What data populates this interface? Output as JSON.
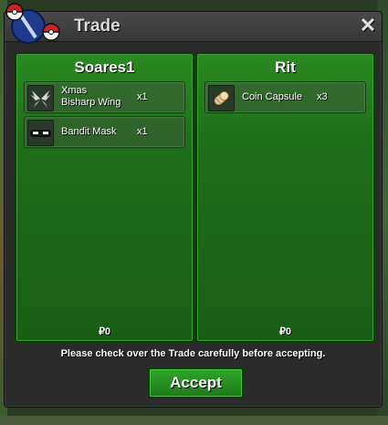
{
  "window": {
    "title": "Trade",
    "close_glyph": "✕"
  },
  "left_panel": {
    "player": "Soares1",
    "items": [
      {
        "name_line1": "Xmas",
        "name_line2": "Bisharp Wing",
        "qty": "x1",
        "icon": "bisharp-wing-icon"
      },
      {
        "name_line1": "Bandit Mask",
        "name_line2": "",
        "qty": "x1",
        "icon": "bandit-mask-icon"
      }
    ],
    "money": "₽0"
  },
  "right_panel": {
    "player": "Rit",
    "items": [
      {
        "name_line1": "Coin Capsule",
        "name_line2": "",
        "qty": "x3",
        "icon": "coin-capsule-icon"
      }
    ],
    "money": "₽0"
  },
  "notice": "Please check over the Trade carefully before accepting.",
  "accept_label": "Accept",
  "colors": {
    "panel_green": "#1f6e1a",
    "accept_green": "#2ea628",
    "window_bg": "#2b2b2b"
  }
}
